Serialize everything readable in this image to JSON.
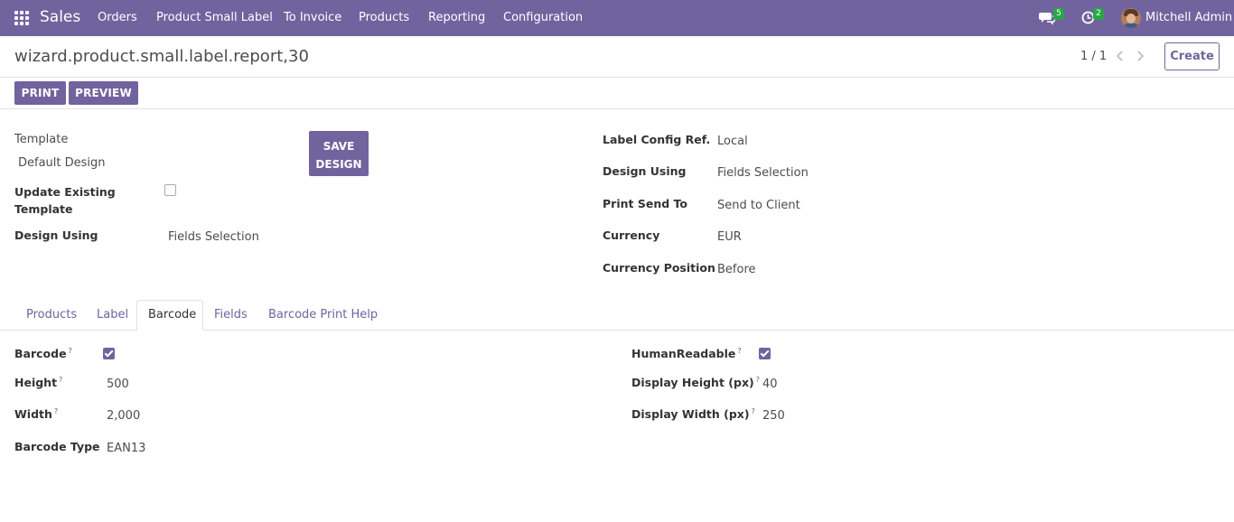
{
  "navbar": {
    "brand": "Sales",
    "menu": [
      "Orders",
      "Product Small Label",
      "To Invoice",
      "Products",
      "Reporting",
      "Configuration"
    ],
    "messages_count": "5",
    "activities_count": "2",
    "user_name": "Mitchell Admin"
  },
  "control_panel": {
    "breadcrumb": "wizard.product.small.label.report,30",
    "pager": "1 / 1",
    "create_label": "Create",
    "print_label": "PRINT",
    "preview_label": "PREVIEW"
  },
  "form": {
    "template_label": "Template",
    "template_value": "Default Design",
    "save_design_line1": "SAVE",
    "save_design_line2": "DESIGN",
    "update_existing_line1": "Update Existing",
    "update_existing_line2": "Template",
    "update_existing_checked": false,
    "design_using_label": "Design Using",
    "design_using_value": "Fields Selection",
    "right": {
      "label_config_label": "Label Config Ref.",
      "label_config_value": "Local",
      "design_using_label": "Design Using",
      "design_using_value": "Fields Selection",
      "print_send_label": "Print Send To",
      "print_send_value": "Send to Client",
      "currency_label": "Currency",
      "currency_value": "EUR",
      "currency_position_label": "Currency Position",
      "currency_position_value": "Before"
    }
  },
  "tabs": [
    "Products",
    "Label",
    "Barcode",
    "Fields",
    "Barcode Print Help"
  ],
  "active_tab": "Barcode",
  "barcode_tab": {
    "barcode_label": "Barcode",
    "barcode_checked": true,
    "height_label": "Height",
    "height_value": "500",
    "width_label": "Width",
    "width_value": "2,000",
    "barcode_type_label": "Barcode Type",
    "barcode_type_value": "EAN13",
    "human_readable_label": "HumanReadable",
    "human_readable_checked": true,
    "display_height_label": "Display Height (px)",
    "display_height_value": "40",
    "display_width_label": "Display Width (px)",
    "display_width_value": "250",
    "help_mark": "?"
  },
  "colors": {
    "primary": "#71639e",
    "badge": "#28a745"
  }
}
